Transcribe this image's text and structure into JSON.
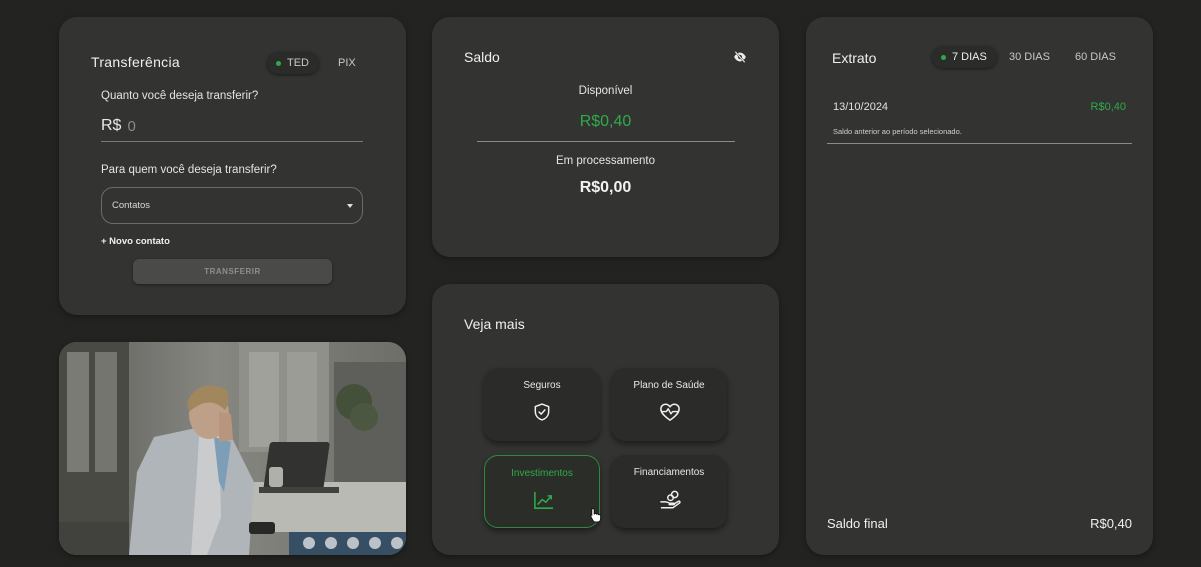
{
  "transfer": {
    "title": "Transferência",
    "tabs": {
      "ted": "TED",
      "pix": "PIX"
    },
    "question_amount": "Quanto você deseja transferir?",
    "currency": "R$",
    "amount_placeholder": "0",
    "question_recipient": "Para quem você deseja transferir?",
    "recipient_select": "Contatos",
    "new_contact": "+ Novo contato",
    "submit": "TRANSFERIR"
  },
  "saldo": {
    "title": "Saldo",
    "available_label": "Disponível",
    "available_value": "R$0,40",
    "processing_label": "Em processamento",
    "processing_value": "R$0,00"
  },
  "veja_mais": {
    "title": "Veja mais",
    "tiles": [
      {
        "label": "Seguros",
        "icon": "shield-check-icon"
      },
      {
        "label": "Plano de Saúde",
        "icon": "heart-pulse-icon"
      },
      {
        "label": "Investimentos",
        "icon": "trending-up-icon"
      },
      {
        "label": "Financiamentos",
        "icon": "hand-coins-icon"
      }
    ]
  },
  "extrato": {
    "title": "Extrato",
    "periods": [
      "7 DIAS",
      "30 DIAS",
      "60 DIAS"
    ],
    "entries": [
      {
        "date": "13/10/2024",
        "amount": "R$0,40",
        "description": "Saldo anterior ao período selecionado."
      }
    ],
    "final_label": "Saldo final",
    "final_value": "R$0,40"
  },
  "colors": {
    "background": "#232321",
    "card": "#333331",
    "accent_green": "#2faa4a"
  }
}
